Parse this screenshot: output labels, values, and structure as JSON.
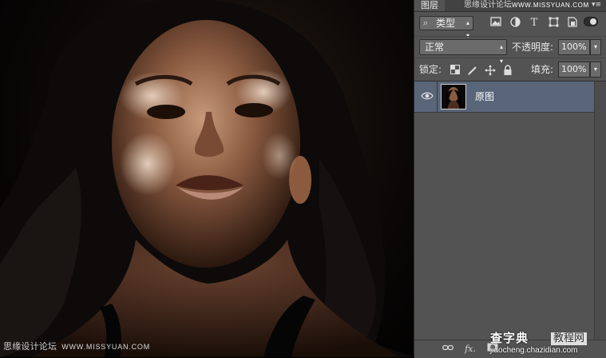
{
  "canvas": {
    "watermark_text": "思缘设计论坛",
    "watermark_url": "WWW.MISSYUAN.COM"
  },
  "layers_panel": {
    "tab_label": "图层",
    "top_watermark_text": "思缘设计论坛",
    "top_watermark_url": "WWW.MISSYUAN.COM",
    "menu_icon": "panel-menu-icon",
    "filter": {
      "kind_label": "类型",
      "icons": [
        "pixel-filter-icon",
        "adjustment-filter-icon",
        "type-filter-icon",
        "shape-filter-icon",
        "smart-object-filter-icon"
      ]
    },
    "blend_mode": "正常",
    "opacity_label": "不透明度:",
    "opacity_value": "100%",
    "lock_label": "锁定:",
    "lock_icons": [
      "lock-transparent-icon",
      "lock-pixels-icon",
      "lock-position-icon",
      "lock-all-icon"
    ],
    "fill_label": "填充:",
    "fill_value": "100%",
    "layers": [
      {
        "name": "原图",
        "visible": true,
        "selected": true
      }
    ],
    "bottom_icons": [
      "link-layers-icon",
      "fx-icon",
      "add-mask-icon"
    ],
    "fx_label": "fx."
  },
  "site_watermark": {
    "brand": "查字典",
    "section": "教程网",
    "url": "jiaocheng.chazidian.com"
  },
  "colors": {
    "panel_bg": "#535353",
    "selected_layer": "#596579",
    "canvas_bg": "#000000"
  }
}
